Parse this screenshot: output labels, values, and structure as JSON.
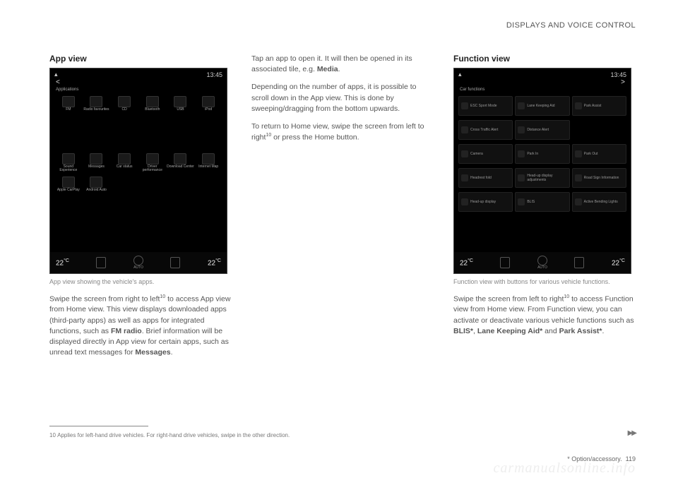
{
  "header": {
    "section_name": "DISPLAYS AND VOICE CONTROL"
  },
  "col1": {
    "title": "App view",
    "device": {
      "clock": "13:45",
      "back": "<",
      "subheader": "Applications",
      "apps_row1": [
        {
          "label": "FM"
        },
        {
          "label": "Radio favourites"
        },
        {
          "label": "CD"
        },
        {
          "label": "Bluetooth"
        },
        {
          "label": "USB"
        },
        {
          "label": "iPod"
        }
      ],
      "apps_row2": [
        {
          "label": "Sound Experience"
        },
        {
          "label": "Messages"
        },
        {
          "label": "Car status"
        },
        {
          "label": "Driver performance"
        },
        {
          "label": "Download Center"
        },
        {
          "label": "Internet Map"
        }
      ],
      "apps_row3": [
        {
          "label": "Apple CarPlay"
        },
        {
          "label": "Android Auto"
        }
      ],
      "temp_left": "22",
      "temp_right": "22",
      "deg": "°C",
      "auto": "AUTO"
    },
    "caption": "App view showing the vehicle's apps.",
    "para1_pre": "Swipe the screen from right to left",
    "para1_sup": "10",
    "para1_post": " to access App view from Home view. This view displays downloaded apps (third-party apps) as well as apps for integrated functions, such as ",
    "para1_bold1": "FM radio",
    "para1_mid": ". Brief information will be displayed directly in App view for certain apps, such as unread text messages for ",
    "para1_bold2": "Messages",
    "para1_end": "."
  },
  "col2": {
    "para1": "Tap an app to open it. It will then be opened in its associated tile, e.g. ",
    "para1_bold": "Media",
    "para1_end": ".",
    "para2": "Depending on the number of apps, it is possible to scroll down in the App view. This is done by sweeping/dragging from the bottom upwards.",
    "para3_pre": "To return to Home view, swipe the screen from left to right",
    "para3_sup": "10",
    "para3_post": " or press the Home button."
  },
  "col3": {
    "title": "Function view",
    "device": {
      "clock": "13:45",
      "back": ">",
      "subheader": "Car functions",
      "rows": [
        [
          {
            "l": "ESC Sport Mode"
          },
          {
            "l": "Lane Keeping Aid"
          },
          {
            "l": "Park Assist"
          }
        ],
        [
          {
            "l": "Cross Traffic Alert"
          },
          {
            "l": "Distance Alert"
          },
          {
            "l": ""
          }
        ],
        [
          {
            "l": "Camera"
          },
          {
            "l": "Park In"
          },
          {
            "l": "Park Out"
          }
        ],
        [
          {
            "l": "Headrest fold"
          },
          {
            "l": "Head-up display adjustments"
          },
          {
            "l": "Road Sign Information"
          }
        ],
        [
          {
            "l": "Head-up display"
          },
          {
            "l": "BLIS"
          },
          {
            "l": "Active Bending Lights"
          }
        ]
      ],
      "temp_left": "22",
      "temp_right": "22",
      "deg": "°C",
      "auto": "AUTO"
    },
    "caption": "Function view with buttons for various vehicle functions.",
    "para1_pre": "Swipe the screen from left to right",
    "para1_sup": "10",
    "para1_post": " to access Function view from Home view. From Function view, you can activate or deactivate various vehicle functions such as ",
    "para1_b1": "BLIS*",
    "para1_m1": ", ",
    "para1_b2": "Lane Keeping Aid*",
    "para1_m2": " and ",
    "para1_b3": "Park Assist*",
    "para1_end": "."
  },
  "footnote": {
    "num": "10",
    "text": "Applies for left-hand drive vehicles. For right-hand drive vehicles, swipe in the other direction."
  },
  "continue": "▶▶",
  "footer": {
    "option_note": "* Option/accessory.",
    "page_num": "119"
  },
  "watermark": "carmanualsonline.info"
}
